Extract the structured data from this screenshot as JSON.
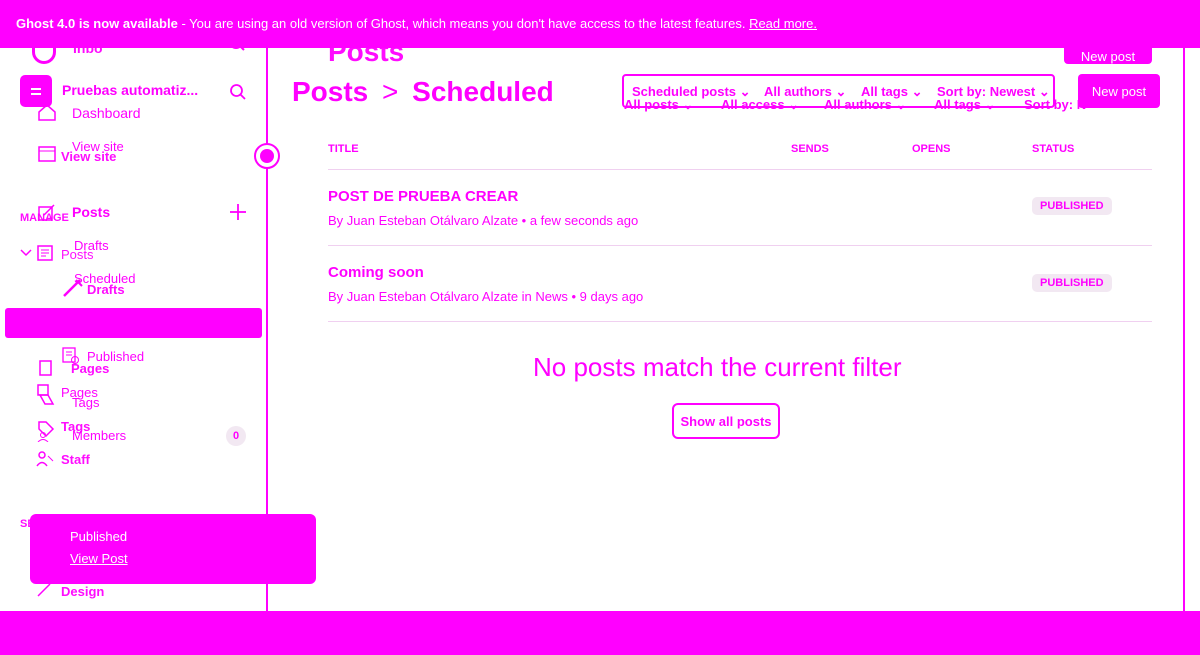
{
  "banner": {
    "title": "Ghost 4.0 is now available",
    "message": " - You are using an old version of Ghost, which means you don't have access to the latest features. ",
    "link": "Read more."
  },
  "ghost_behind": {
    "site_short": "Inbo",
    "page_title": "Posts",
    "new_post": "New post",
    "manage": "MANAGE",
    "posts": "Posts",
    "drafts": "Drafts",
    "pages": "Pages",
    "tags": "Tags",
    "staff": "Staff",
    "settings": "SE",
    "view_site": "View site",
    "design": "Design",
    "filters": [
      "All posts",
      "All access",
      "All authors",
      "All tags",
      "Sort by: N"
    ]
  },
  "sidebar": {
    "site_name": "Pruebas automatiz...",
    "dashboard": "Dashboard",
    "view_site": "View site",
    "posts": "Posts",
    "drafts": "Drafts",
    "scheduled": "Scheduled",
    "published": "Published",
    "pages": "Pages",
    "tags": "Tags",
    "members": "Members",
    "members_count": "0"
  },
  "header": {
    "crumb1": "Posts",
    "separator": ">",
    "crumb2": "Scheduled",
    "new_post": "New post"
  },
  "filters": [
    "Scheduled posts",
    "All authors",
    "All tags",
    "Sort by: Newest"
  ],
  "table": {
    "headers": [
      "TITLE",
      "SENDS",
      "OPENS",
      "STATUS"
    ],
    "rows": [
      {
        "title": "POST DE PRUEBA CREAR",
        "meta": "By Juan Esteban Otálvaro Alzate • a few seconds ago",
        "status": "PUBLISHED"
      },
      {
        "title": "Coming soon",
        "meta": "By Juan Esteban Otálvaro Alzate in News • 9 days ago",
        "status": "PUBLISHED"
      }
    ],
    "empty_message": "No posts match the current filter",
    "show_all": "Show all posts"
  },
  "toast": {
    "text": "Published",
    "link": "View Post"
  }
}
